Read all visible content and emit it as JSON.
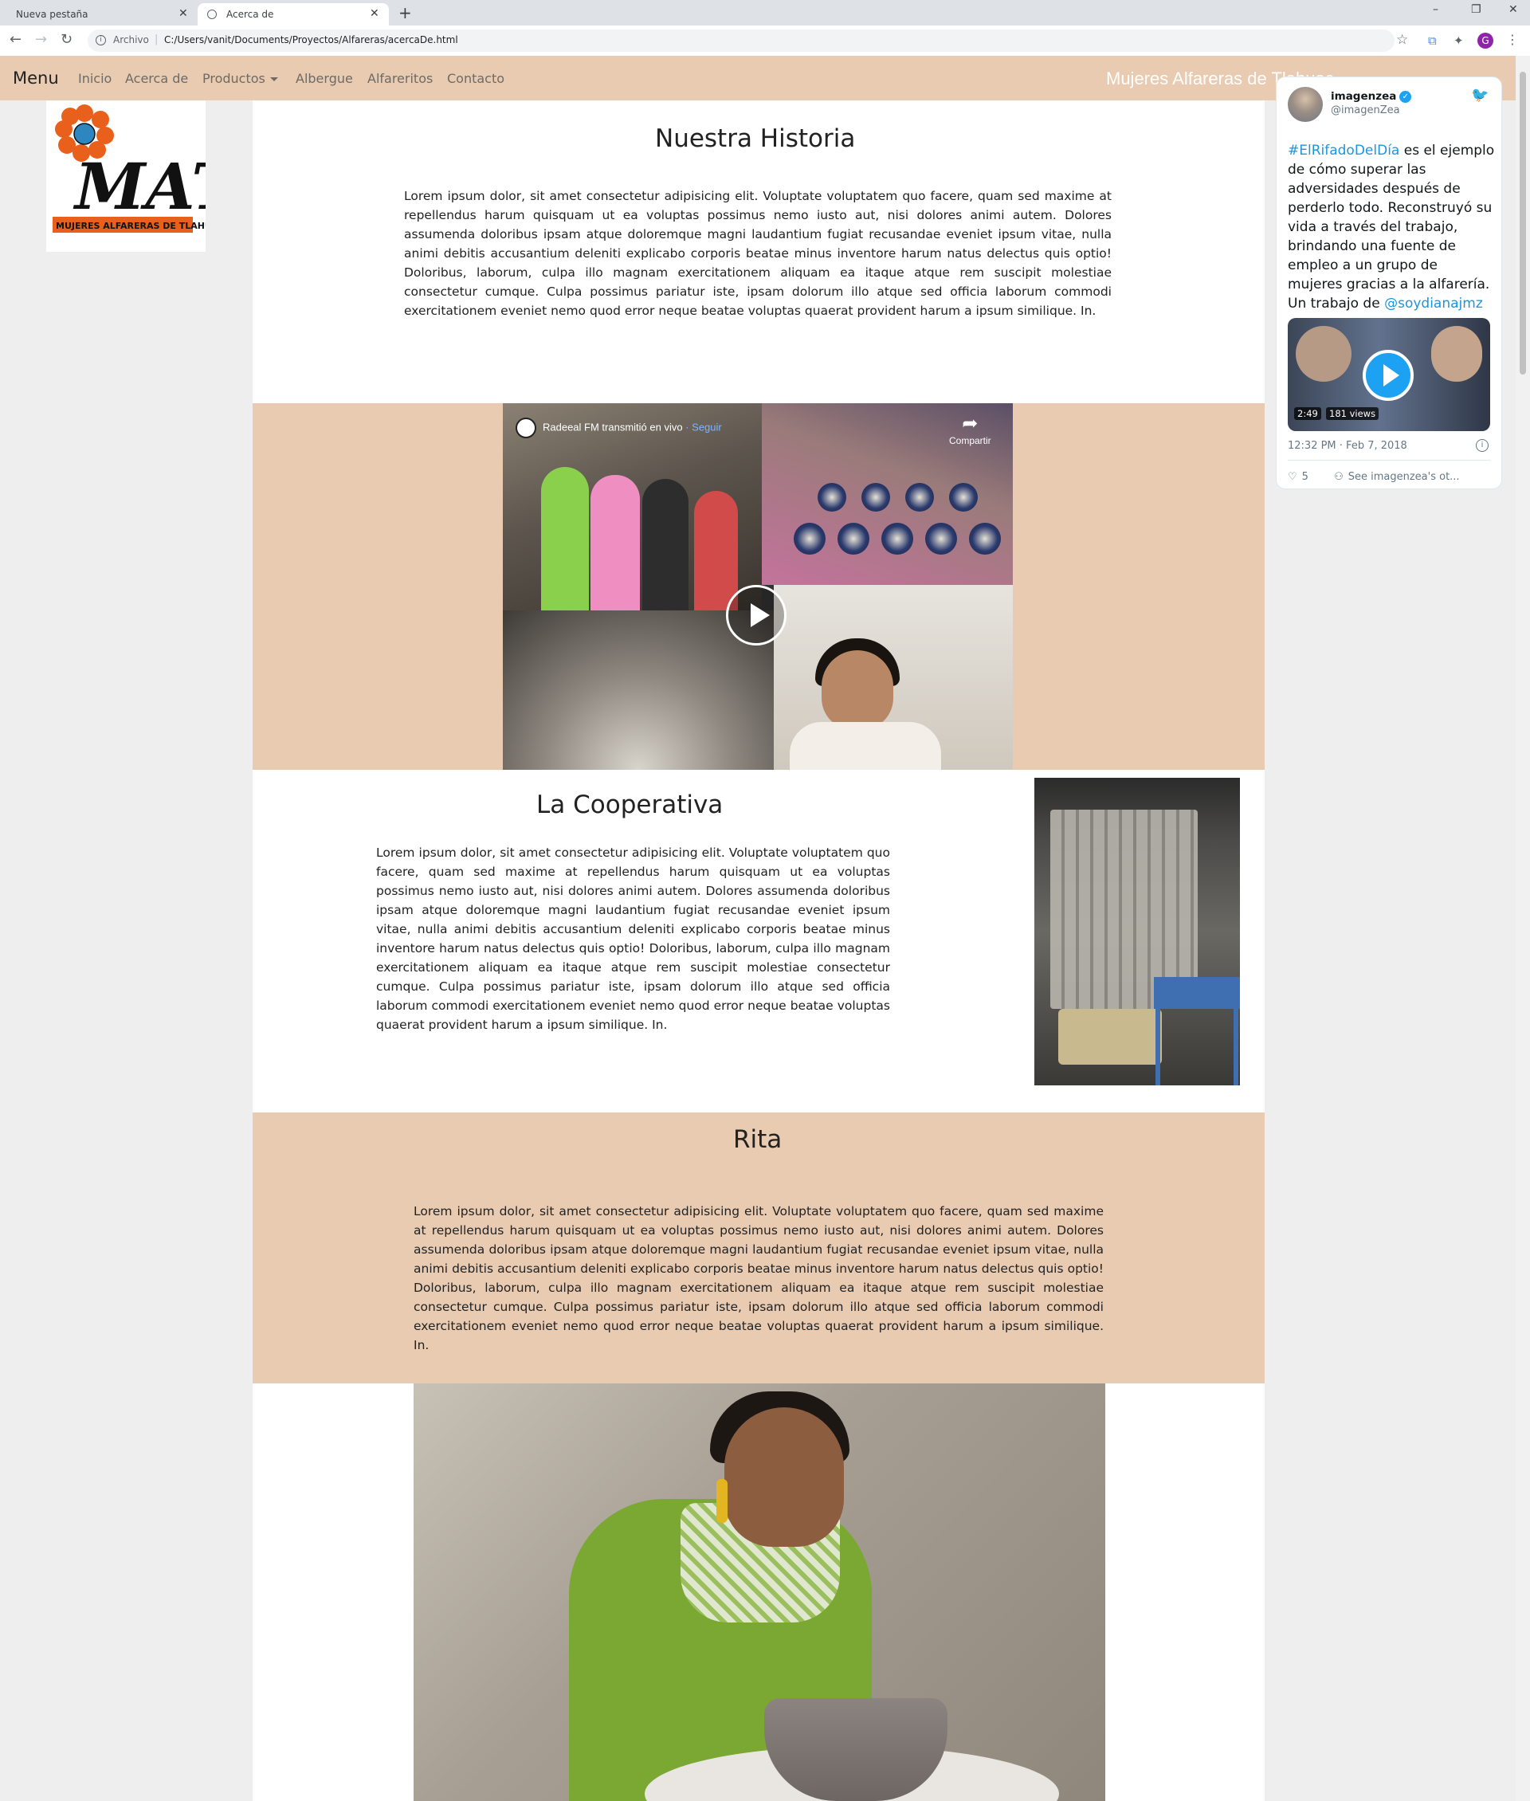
{
  "browser": {
    "tabs": [
      {
        "title": "Nueva pestaña",
        "active": false
      },
      {
        "title": "Acerca de",
        "active": true
      }
    ],
    "new_tab_icon": "+",
    "address": {
      "scheme_label": "Archivo",
      "url": "C:/Users/vanit/Documents/Proyectos/Alfareras/acercaDe.html"
    },
    "profile_initial": "G"
  },
  "navbar": {
    "brand": "Menu",
    "links": [
      {
        "label": "Inicio"
      },
      {
        "label": "Acerca de"
      },
      {
        "label": "Productos",
        "dropdown": true
      },
      {
        "label": "Albergue"
      },
      {
        "label": "Alfareritos"
      },
      {
        "label": "Contacto"
      }
    ],
    "site_title": "Mujeres Alfareras de Tlahuac"
  },
  "logo": {
    "letters": "MAT",
    "caption": "MUJERES ALFARERAS DE TLAHUAC",
    "colors": {
      "flower": "#e8601c",
      "center": "#2e86c1",
      "banner": "#e8601c"
    }
  },
  "sections": {
    "historia": {
      "title": "Nuestra Historia",
      "body": "Lorem ipsum dolor, sit amet consectetur adipisicing elit. Voluptate voluptatem quo facere, quam sed maxime at repellendus harum quisquam ut ea voluptas possimus nemo iusto aut, nisi dolores animi autem. Dolores assumenda doloribus ipsam atque doloremque magni laudantium fugiat recusandae eveniet ipsum vitae, nulla animi debitis accusantium deleniti explicabo corporis beatae minus inventore harum natus delectus quis optio! Doloribus, laborum, culpa illo magnam exercitationem aliquam ea itaque atque rem suscipit molestiae consectetur cumque. Culpa possimus pariatur iste, ipsam dolorum illo atque sed officia laborum commodi exercitationem eveniet nemo quod error neque beatae voluptas quaerat provident harum a ipsum similique. In."
    },
    "video": {
      "channel": "Radeeal FM transmitió en vivo",
      "follow": "· Seguir",
      "share": "Compartir"
    },
    "cooperativa": {
      "title": "La Cooperativa",
      "body": "Lorem ipsum dolor, sit amet consectetur adipisicing elit. Voluptate voluptatem quo facere, quam sed maxime at repellendus harum quisquam ut ea voluptas possimus nemo iusto aut, nisi dolores animi autem. Dolores assumenda doloribus ipsam atque doloremque magni laudantium fugiat recusandae eveniet ipsum vitae, nulla animi debitis accusantium deleniti explicabo corporis beatae minus inventore harum natus delectus quis optio! Doloribus, laborum, culpa illo magnam exercitationem aliquam ea itaque atque rem suscipit molestiae consectetur cumque. Culpa possimus pariatur iste, ipsam dolorum illo atque sed officia laborum commodi exercitationem eveniet nemo quod error neque beatae voluptas quaerat provident harum a ipsum similique. In."
    },
    "rita": {
      "title": "Rita",
      "body": "Lorem ipsum dolor, sit amet consectetur adipisicing elit. Voluptate voluptatem quo facere, quam sed maxime at repellendus harum quisquam ut ea voluptas possimus nemo iusto aut, nisi dolores animi autem. Dolores assumenda doloribus ipsam atque doloremque magni laudantium fugiat recusandae eveniet ipsum vitae, nulla animi debitis accusantium deleniti explicabo corporis beatae minus inventore harum natus delectus quis optio! Doloribus, laborum, culpa illo magnam exercitationem aliquam ea itaque atque rem suscipit molestiae consectetur cumque. Culpa possimus pariatur iste, ipsam dolorum illo atque sed officia laborum commodi exercitationem eveniet nemo quod error neque beatae voluptas quaerat provident harum a ipsum similique. In."
    }
  },
  "tweet": {
    "name": "imagenzea",
    "handle": "@imagenZea",
    "hashtag": "#ElRifadoDelDía",
    "text_main": " es el ejemplo de cómo superar las adversidades después de perderlo todo. Reconstruyó su vida a través del trabajo, brindando una fuente de empleo a un grupo de mujeres gracias a la alfarería. Un trabajo de ",
    "mention": "@soydianajmz",
    "duration": "2:49",
    "views": "181 views",
    "timestamp": "12:32 PM · Feb 7, 2018",
    "likes": "5",
    "see_more": "See imagenzea's ot..."
  },
  "colors": {
    "accent": "#e8cbb1",
    "twitter_blue": "#1da1f2",
    "nav_text": "#6e6a66"
  }
}
